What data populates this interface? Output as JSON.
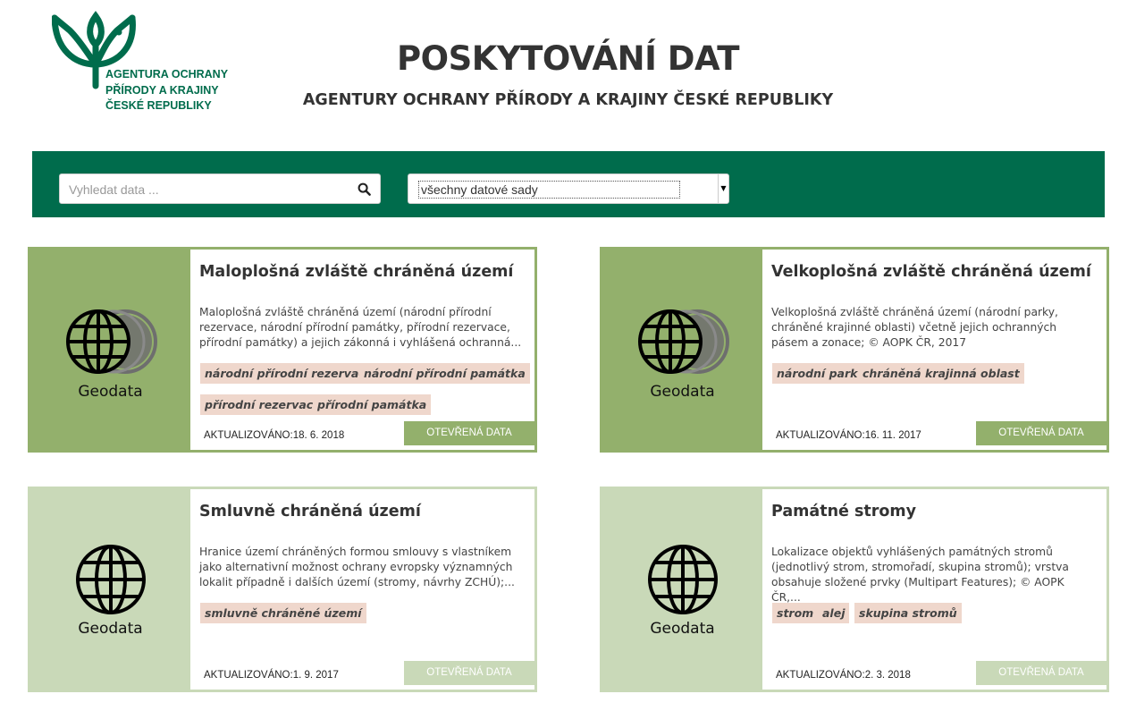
{
  "header": {
    "logo_lines": [
      "AGENTURA OCHRANY",
      "PŘÍRODY A KRAJINY",
      "ČESKÉ REPUBLIKY"
    ],
    "title": "POSKYTOVÁNÍ DAT",
    "subtitle": "AGENTURY OCHRANY PŘÍRODY A KRAJINY ČESKÉ REPUBLIKY"
  },
  "search": {
    "placeholder": "Vyhledat data ...",
    "value": "",
    "icon": "search-icon"
  },
  "filter": {
    "selected": "všechny datové sady"
  },
  "colors": {
    "brand_green": "#006c4c",
    "card_green": "#93b06c",
    "card_green_light": "#c9d9b8",
    "tag_bg": "#efd7cc"
  },
  "cards": [
    {
      "title": "Maloplošná zvláště chráněná území",
      "description": "Maloplošná zvláště chráněná území (národní přírodní rezervace, národní přírodní památky, přírodní rezervace, přírodní památky) a jejich zákonná i vyhlášená ochranná...",
      "tags": [
        "národní přírodní rezervace",
        "národní přírodní památka",
        "přírodní rezervace",
        "přírodní památka"
      ],
      "type_label": "Geodata",
      "updated_label": "AKTUALIZOVÁNO:",
      "updated_date": "18. 6. 2018",
      "button_label": "OTEVŘENÁ DATA"
    },
    {
      "title": "Velkoplošná zvláště chráněná území",
      "description": "Velkoplošná zvláště chráněná území (národní parky, chráněné krajinné oblasti) včetně jejich ochranných pásem a zonace; © AOPK ČR, 2017",
      "tags": [
        "národní park",
        "chráněná krajinná oblast"
      ],
      "type_label": "Geodata",
      "updated_label": "AKTUALIZOVÁNO:",
      "updated_date": "16. 11. 2017",
      "button_label": "OTEVŘENÁ DATA"
    },
    {
      "title": "Smluvně chráněná území",
      "description": "Hranice území chráněných formou smlouvy s vlastníkem jako alternativní možnost ochrany evropsky významných lokalit případně i dalších území (stromy, návrhy ZCHÚ);...",
      "tags": [
        "smluvně chráněné území"
      ],
      "type_label": "Geodata",
      "updated_label": "AKTUALIZOVÁNO:",
      "updated_date": "1. 9. 2017",
      "button_label": "OTEVŘENÁ DATA"
    },
    {
      "title": "Památné stromy",
      "description": "Lokalizace objektů vyhlášených památných stromů (jednotlivý strom, stromořadí, skupina stromů); vrstva obsahuje složené prvky (Multipart Features); © AOPK ČR,...",
      "tags": [
        "strom",
        "alej",
        "skupina stromů"
      ],
      "type_label": "Geodata",
      "updated_label": "AKTUALIZOVÁNO:",
      "updated_date": "2. 3. 2018",
      "button_label": "OTEVŘENÁ DATA"
    }
  ]
}
